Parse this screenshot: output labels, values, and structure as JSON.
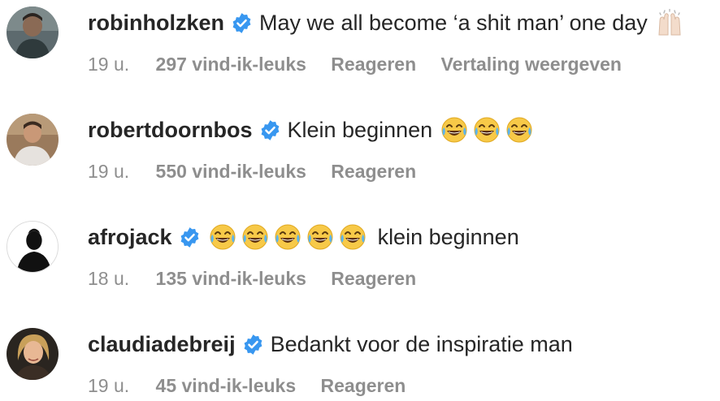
{
  "comments": [
    {
      "username": "robinholzken",
      "verified": true,
      "text": "May we all become ‘a shit man’ one day",
      "emojis_before": [],
      "emojis_after": [
        "raised-hands-emoji"
      ],
      "time": "19 u.",
      "likes": "297 vind-ik-leuks",
      "reply": "Reageren",
      "translate": "Vertaling weergeven"
    },
    {
      "username": "robertdoornbos",
      "verified": true,
      "text": "Klein beginnen",
      "emojis_before": [],
      "emojis_after": [
        "tears-of-joy-emoji",
        "tears-of-joy-emoji",
        "tears-of-joy-emoji"
      ],
      "time": "19 u.",
      "likes": "550 vind-ik-leuks",
      "reply": "Reageren"
    },
    {
      "username": "afrojack",
      "verified": true,
      "text": "klein beginnen",
      "emojis_before": [
        "tears-of-joy-emoji",
        "tears-of-joy-emoji",
        "tears-of-joy-emoji",
        "tears-of-joy-emoji",
        "tears-of-joy-emoji"
      ],
      "emojis_after": [],
      "time": "18 u.",
      "likes": "135 vind-ik-leuks",
      "reply": "Reageren"
    },
    {
      "username": "claudiadebreij",
      "verified": true,
      "text": "Bedankt voor de inspiratie man",
      "emojis_before": [],
      "emojis_after": [],
      "time": "19 u.",
      "likes": "45 vind-ik-leuks",
      "reply": "Reageren"
    }
  ],
  "colors": {
    "primary_text": "#262626",
    "secondary_text": "#8e8e8e",
    "verified_badge": "#3897f0",
    "background": "#ffffff"
  }
}
